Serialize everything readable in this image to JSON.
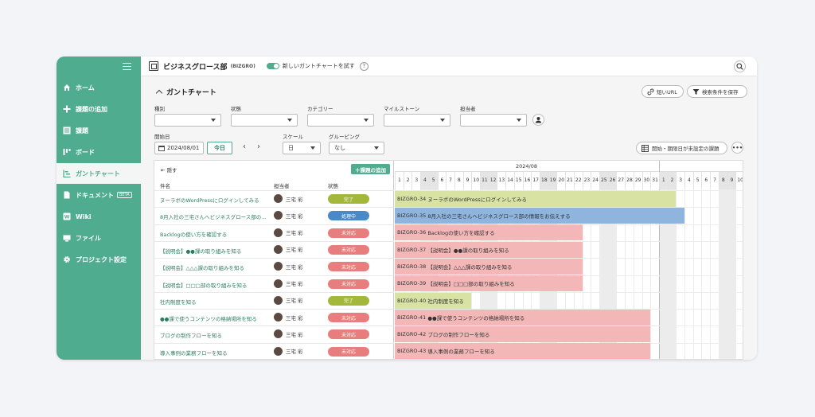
{
  "sidebar": {
    "items": [
      {
        "label": "ホーム",
        "icon": "home-icon"
      },
      {
        "label": "課題の追加",
        "icon": "plus-icon"
      },
      {
        "label": "課題",
        "icon": "list-icon"
      },
      {
        "label": "ボード",
        "icon": "board-icon"
      },
      {
        "label": "ガントチャート",
        "icon": "gantt-icon"
      },
      {
        "label": "ドキュメント",
        "icon": "document-icon",
        "badge": "BETA"
      },
      {
        "label": "Wiki",
        "icon": "wiki-icon"
      },
      {
        "label": "ファイル",
        "icon": "file-icon"
      },
      {
        "label": "プロジェクト設定",
        "icon": "gear-icon"
      }
    ],
    "active_index": 4
  },
  "header": {
    "project_name": "ビジネスグロース部",
    "project_key": "(BIZGRO)",
    "toggle_label": "新しいガントチャートを試す",
    "help": "?"
  },
  "page": {
    "title": "ガントチャート",
    "short_url": "短いURL",
    "save_filter": "検索条件を保存"
  },
  "filters": {
    "type_label": "種別",
    "status_label": "状態",
    "category_label": "カテゴリー",
    "milestone_label": "マイルストーン",
    "assignee_label": "担当者",
    "start_date_label": "開始日",
    "start_date_value": "2024/08/01",
    "today_button": "今日",
    "scale_label": "スケール",
    "scale_value": "日",
    "grouping_label": "グルーピング",
    "grouping_value": "なし",
    "unset_dates_button": "開始・期限日が未設定の課題"
  },
  "table": {
    "hide_label": "隠す",
    "add_issue_label": "課題の追加",
    "columns": [
      "件名",
      "担当者",
      "状態"
    ],
    "month_label": "2024/08",
    "days": [
      "1",
      "2",
      "3",
      "4",
      "5",
      "6",
      "7",
      "8",
      "9",
      "10",
      "11",
      "12",
      "13",
      "14",
      "15",
      "16",
      "17",
      "18",
      "19",
      "20",
      "21",
      "22",
      "23",
      "24",
      "25",
      "26",
      "27",
      "28",
      "29",
      "30",
      "31",
      "1",
      "2",
      "3",
      "4",
      "5",
      "6",
      "7",
      "8",
      "9",
      "10"
    ],
    "rows": [
      {
        "subject": "ヌーラボのWordPressにログインしてみる",
        "assignee": "三宅 彩",
        "status": "完了",
        "key": "BIZGRO-34",
        "bar_label": "ヌーラボのWordPressにログインしてみる"
      },
      {
        "subject": "8月入社の三宅さんへビジネスグロース部の...",
        "assignee": "三宅 彩",
        "status": "処理中",
        "key": "BIZGRO-35",
        "bar_label": "8月入社の三宅さんへビジネスグロース部の情報をお伝えする"
      },
      {
        "subject": "Backlogの使い方を確認する",
        "assignee": "三宅 彩",
        "status": "未対応",
        "key": "BIZGRO-36",
        "bar_label": "Backlogの使い方を確認する"
      },
      {
        "subject": "【説明会】●●課の取り組みを知る",
        "assignee": "三宅 彩",
        "status": "未対応",
        "key": "BIZGRO-37",
        "bar_label": "【説明会】●●課の取り組みを知る"
      },
      {
        "subject": "【説明会】△△△課の取り組みを知る",
        "assignee": "三宅 彩",
        "status": "未対応",
        "key": "BIZGRO-38",
        "bar_label": "【説明会】△△△課の取り組みを知る"
      },
      {
        "subject": "【説明会】□□□部の取り組みを知る",
        "assignee": "三宅 彩",
        "status": "未対応",
        "key": "BIZGRO-39",
        "bar_label": "【説明会】□□□部の取り組みを知る"
      },
      {
        "subject": "社内制度を知る",
        "assignee": "三宅 彩",
        "status": "完了",
        "key": "BIZGRO-40",
        "bar_label": "社内制度を知る"
      },
      {
        "subject": "●●課で使うコンテンツの格納場所を知る",
        "assignee": "三宅 彩",
        "status": "未対応",
        "key": "BIZGRO-41",
        "bar_label": "●●課で使うコンテンツの格納場所を知る"
      },
      {
        "subject": "ブログの制作フローを知る",
        "assignee": "三宅 彩",
        "status": "未対応",
        "key": "BIZGRO-42",
        "bar_label": "ブログの制作フローを知る"
      },
      {
        "subject": "導入事例の業務フローを知る",
        "assignee": "三宅 彩",
        "status": "未対応",
        "key": "BIZGRO-43",
        "bar_label": "導入事例の業務フローを知る"
      }
    ]
  },
  "colors": {
    "brand": "#4fac8e",
    "status_done": "#a3b83a",
    "status_in_progress": "#4a88c7",
    "status_open": "#e77d7d",
    "bar_done": "#d7e2a3",
    "bar_in_progress": "#8fb5df",
    "bar_open": "#f3b7b7"
  }
}
